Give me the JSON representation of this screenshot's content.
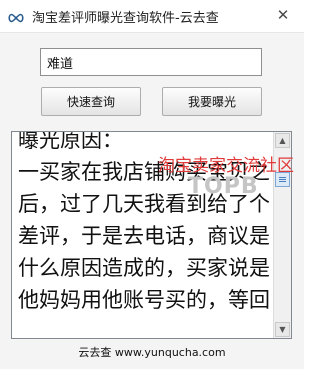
{
  "window": {
    "title": "淘宝差评师曝光查询软件-云去查",
    "close_symbol": "✕",
    "icon": "infinity-icon"
  },
  "search": {
    "value": "难道"
  },
  "buttons": {
    "query_label": "快速查询",
    "expose_label": "我要曝光"
  },
  "result": {
    "heading": "曝光原因：",
    "body": "一买家在我店铺购买宝贝之后，过了几天我看到给了个差评，于是去电话，商议是什么原因造成的，买家说是他妈妈用他账号买的，等回"
  },
  "scrollbar": {
    "up_icon": "scroll-up-arrow",
    "down_icon": "scroll-down-arrow"
  },
  "footer": {
    "text": "云去查 www.yunqucha.com"
  },
  "watermark": {
    "text": "淘宝卖家交流社区",
    "logo_text": "TOPB"
  },
  "colors": {
    "watermark_red": "#e03a3a",
    "scroll_thumb": "#dce9f7",
    "window_bg": "#f4f4f4"
  }
}
